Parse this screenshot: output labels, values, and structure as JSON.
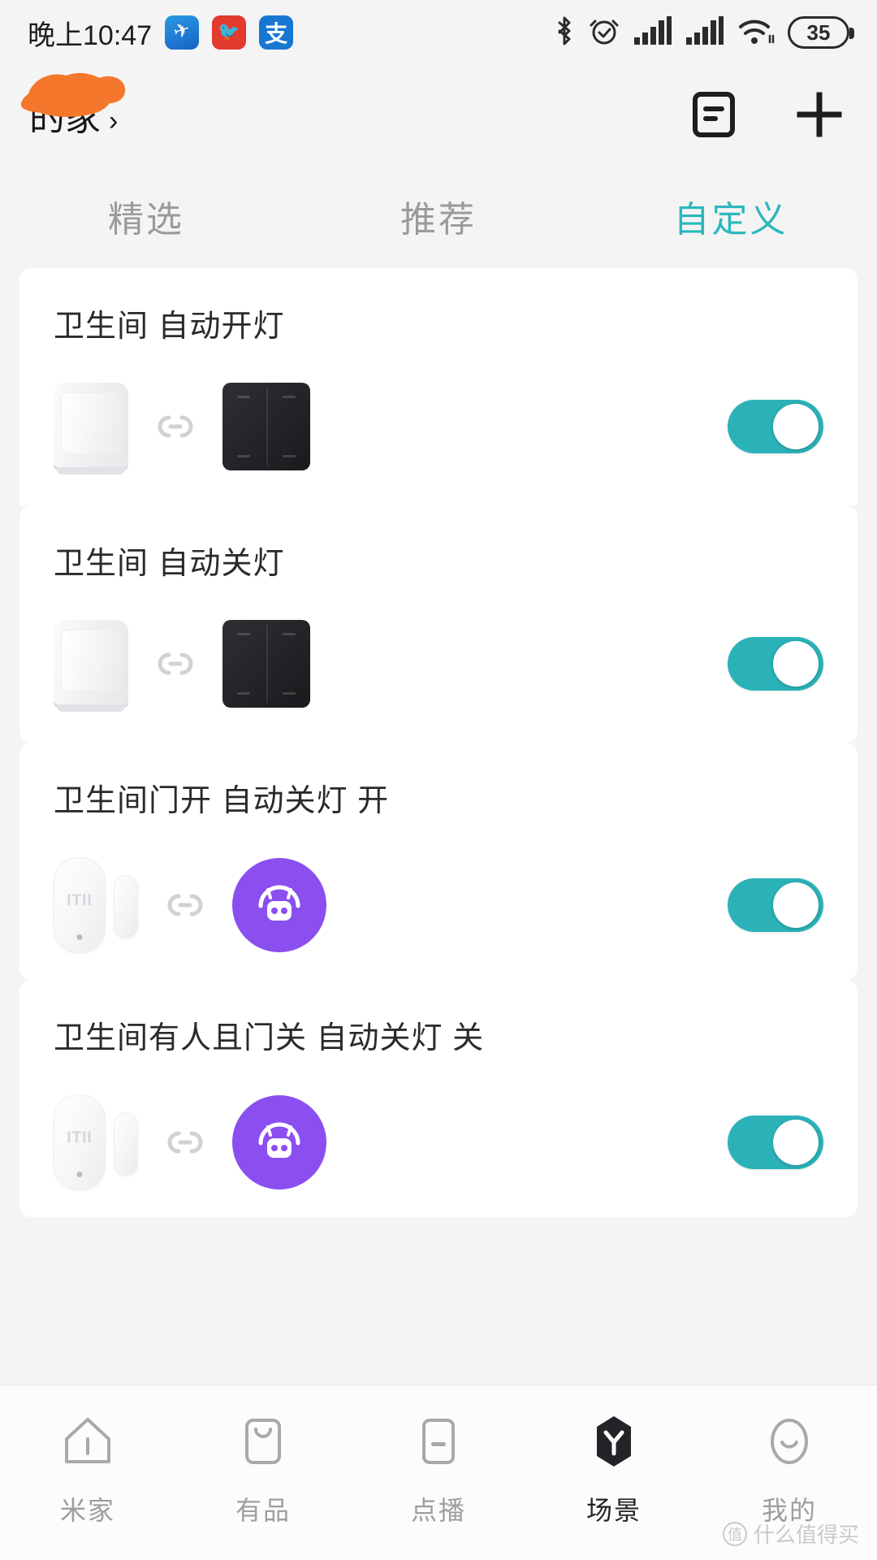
{
  "statusbar": {
    "clock": "晚上10:47",
    "app_icons": [
      "airplane-app-icon",
      "bird-app-icon",
      "alipay-app-icon"
    ],
    "icons": [
      "bluetooth-icon",
      "alarm-icon",
      "signal-1-icon",
      "signal-2-icon",
      "wifi-icon"
    ],
    "battery_level": "35"
  },
  "header": {
    "home_name": "的家",
    "home_name_redacted": true,
    "chevron": "›",
    "list_button_label": "list-view",
    "add_button_label": "add"
  },
  "tabs": [
    {
      "label": "精选",
      "active": false
    },
    {
      "label": "推荐",
      "active": false
    },
    {
      "label": "自定义",
      "active": true
    }
  ],
  "colors": {
    "accent_teal": "#2bb7bd",
    "toggle_on": "#2bb2b8",
    "automation_purple": "#8b4ff0",
    "page_bg": "#f4f4f4",
    "card_bg": "#ffffff"
  },
  "scenes": [
    {
      "title": "卫生间 自动开灯",
      "trigger_device": "motion-sensor",
      "action_device": "wall-switch",
      "link_icon": "chain-link-icon",
      "enabled": true
    },
    {
      "title": "卫生间 自动关灯",
      "trigger_device": "motion-sensor",
      "action_device": "wall-switch",
      "link_icon": "chain-link-icon",
      "enabled": true
    },
    {
      "title": "卫生间门开 自动关灯 开",
      "trigger_device": "door-sensor",
      "action_device": "automation-robot",
      "link_icon": "chain-link-icon",
      "enabled": true
    },
    {
      "title": "卫生间有人且门关 自动关灯 关",
      "trigger_device": "door-sensor",
      "action_device": "automation-robot",
      "link_icon": "chain-link-icon",
      "enabled": true
    }
  ],
  "bottomnav": [
    {
      "label": "米家",
      "icon": "home-icon",
      "active": false
    },
    {
      "label": "有品",
      "icon": "bag-icon",
      "active": false
    },
    {
      "label": "点播",
      "icon": "player-icon",
      "active": false
    },
    {
      "label": "场景",
      "icon": "scene-icon",
      "active": true
    },
    {
      "label": "我的",
      "icon": "profile-icon",
      "active": false
    }
  ],
  "watermark": {
    "badge": "值",
    "text": "什么值得买"
  }
}
